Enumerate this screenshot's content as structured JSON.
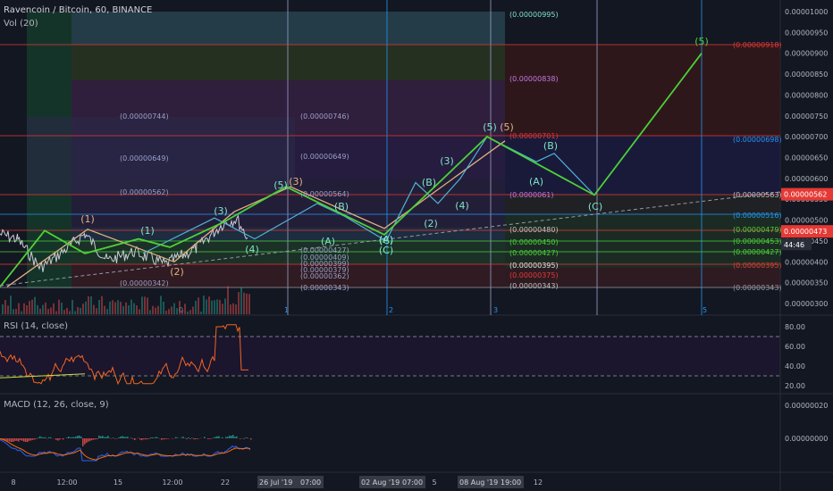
{
  "header": {
    "symbol": "Ravencoin / Bitcoin, 60, BINANCE",
    "vol": "Vol (20)",
    "rsi": "RSI (14, close)",
    "macd": "MACD (12, 26, close, 9)"
  },
  "colors": {
    "background": "#131722",
    "impulse": "#4cd137",
    "teal": "#7fe3c8",
    "orange": "#e0b080",
    "rsi": "#f26522",
    "macd": "#2962ff",
    "signal": "#ff6d00",
    "red_line": "#e53935",
    "blue_line": "#2196f3"
  },
  "chart_data": {
    "type": "line",
    "price_axis": {
      "ticks": [
        "0.00001000",
        "0.00000950",
        "0.00000900",
        "0.00000850",
        "0.00000800",
        "0.00000750",
        "0.00000700",
        "0.00000650",
        "0.00000600",
        "0.00000550",
        "0.00000500",
        "0.00000450",
        "0.00000400",
        "0.00000350",
        "0.00000300"
      ],
      "range": [
        3e-06,
        1e-05
      ],
      "current_price": "0.00000473",
      "highlight_price": "0.00000562",
      "countdown": "44:46"
    },
    "rsi_axis": {
      "ticks": [
        "80.00",
        "60.00",
        "40.00",
        "20.00"
      ],
      "range": [
        15,
        90
      ],
      "levels": [
        70,
        30
      ]
    },
    "macd_axis": {
      "ticks": [
        "0.00000020",
        "0.00000000"
      ]
    },
    "time_axis": {
      "labels": [
        "8",
        "12:00",
        "15",
        "12:00",
        "22",
        "5",
        "12"
      ],
      "highlighted": [
        "26 Jul '19",
        "07:00",
        "02 Aug '19",
        "07:00",
        "08 Aug '19",
        "19:00"
      ]
    },
    "fib_levels_right": [
      "(0.00000918)",
      "(0.00000698)",
      "(0.00000563)",
      "(0.00000516)",
      "(0.00000479)",
      "(0.00000453)",
      "(0.00000427)",
      "(0.00000395)",
      "(0.00000343)"
    ],
    "fib_levels_top": [
      "(0.00000995)",
      "(0.00000838)",
      "(0.00000701)",
      "(0.0000061)",
      "(0.00000480)",
      "(0.00000450)",
      "(0.00000427)",
      "(0.00000395)",
      "(0.00000375)",
      "(0.00000343)"
    ],
    "fib_levels_left": [
      "(0.00000744)",
      "(0.00000746)",
      "(0.00000649)",
      "(0.00000649)",
      "(0.00000562)",
      "(0.00000564)",
      "(0.00000427)",
      "(0.00000409)",
      "(0.00000399)",
      "(0.00000379)",
      "(0.00000362)",
      "(0.00000342)",
      "(0.00000343)"
    ],
    "wave_labels": [
      "(1)",
      "(2)",
      "(3)",
      "(4)",
      "(5)",
      "(A)",
      "(B)",
      "(C)",
      "(1)",
      "(2)",
      "(3)",
      "(4)",
      "(5)",
      "(A)",
      "(B)",
      "(C)",
      "(5)",
      "(A)",
      "(B)",
      "(C)",
      "(3)",
      "(5)"
    ],
    "time_markers": [
      "1",
      "2",
      "3",
      "5"
    ],
    "vol_zero": "0",
    "impulse_path": [
      [
        0,
        3.4e-06
      ],
      [
        50,
        4.75e-06
      ],
      [
        95,
        4.2e-06
      ],
      [
        155,
        4.55e-06
      ],
      [
        190,
        4.35e-06
      ],
      [
        250,
        4.95e-06
      ],
      [
        320,
        5.8e-06
      ],
      [
        430,
        4.65e-06
      ],
      [
        545,
        7e-06
      ],
      [
        665,
        5.6e-06
      ],
      [
        785,
        9e-06
      ]
    ],
    "orange_path": [
      [
        8,
        3.4e-06
      ],
      [
        98,
        4.78e-06
      ],
      [
        195,
        4e-06
      ],
      [
        262,
        5.2e-06
      ],
      [
        325,
        5.8e-06
      ],
      [
        430,
        4.8e-06
      ],
      [
        565,
        6.9e-06
      ]
    ],
    "teal_path": [
      [
        160,
        4.2e-06
      ],
      [
        240,
        5.05e-06
      ],
      [
        285,
        4.55e-06
      ],
      [
        355,
        5.4e-06
      ],
      [
        385,
        5.1e-06
      ],
      [
        432,
        4.5e-06
      ],
      [
        465,
        5.9e-06
      ],
      [
        490,
        5.4e-06
      ],
      [
        515,
        6e-06
      ],
      [
        545,
        7e-06
      ],
      [
        600,
        6.4e-06
      ],
      [
        620,
        6.6e-06
      ],
      [
        665,
        5.6e-06
      ]
    ]
  }
}
